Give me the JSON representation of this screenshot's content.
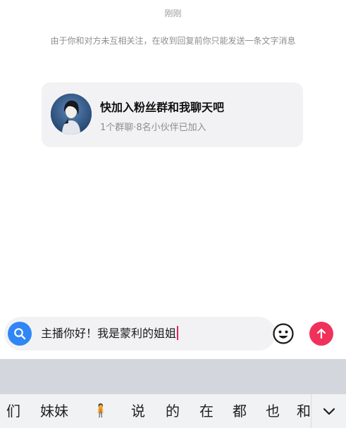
{
  "chat": {
    "timestamp": "刚刚",
    "notice": "由于你和对方未互相关注，在收到回复前你只能发送一条文字消息"
  },
  "group_card": {
    "title": "快加入粉丝群和我聊天吧",
    "subtitle": "1个群聊·8名小伙伴已加入"
  },
  "input": {
    "value": "主播你好！我是蒙利的姐姐",
    "icons": {
      "search": "search-icon",
      "emoji": "emoji-icon",
      "send": "send-arrow-icon"
    }
  },
  "keyboard": {
    "candidates": [
      "们",
      "妹妹",
      "🧍",
      "说",
      "的",
      "在",
      "都",
      "也",
      "和"
    ],
    "collapse_icon": "chevron-down-icon"
  },
  "colors": {
    "accent_blue": "#2f86f6",
    "send_red": "#f0315a",
    "card_bg": "#f2f2f4"
  }
}
